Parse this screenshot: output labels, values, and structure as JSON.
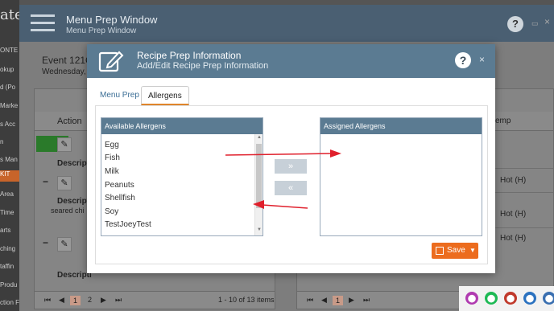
{
  "background_app": {
    "brand": "ate",
    "nav": [
      "ONTE",
      "okup",
      "d (Po",
      "Marke",
      "s Acc",
      "n",
      "s Man",
      "KIT",
      "Area",
      "Time",
      "arts",
      "ching",
      "taffin",
      "Produ",
      "ction F"
    ]
  },
  "menu_prep_window": {
    "title": "Menu Prep Window",
    "subtitle": "Menu Prep Window",
    "help": "?",
    "close": "×",
    "event": "Event 121C",
    "date": "Wednesday,",
    "left_grid": {
      "action_header": "Action",
      "description_label": "Descripti",
      "description_label2": "Descripti",
      "description_text": "seared chi",
      "description_label3": "Descripti",
      "pager_items": [
        "⏮",
        "◀",
        "1",
        "2",
        "▶",
        "⏭"
      ],
      "pager_summary": "1 - 10 of 13 items"
    },
    "right_grid": {
      "temp_header": "emp",
      "hot_values": [
        "Hot (H)",
        "Hot (H)",
        "Hot (H)"
      ],
      "pager_items": [
        "⏮",
        "◀",
        "1",
        "▶",
        "⏭"
      ]
    }
  },
  "modal": {
    "title": "Recipe Prep Information",
    "subtitle": "Add/Edit Recipe Prep Information",
    "help": "?",
    "close": "×",
    "tabs": [
      {
        "label": "Menu Prep",
        "active": false
      },
      {
        "label": "Allergens",
        "active": true
      }
    ],
    "available": {
      "header": "Available Allergens",
      "items": [
        "Egg",
        "Fish",
        "Milk",
        "Peanuts",
        "Shellfish",
        "Soy",
        "TestJoeyTest"
      ]
    },
    "assigned": {
      "header": "Assigned Allergens",
      "items": []
    },
    "move_right": "»",
    "move_left": "«",
    "save_label": "Save",
    "save_caret": "▼"
  },
  "colors": {
    "modal_header": "#5b7b92",
    "save": "#ec6c1e",
    "annotation_arrow": "#e0202c",
    "active_tab_underline": "#e0852b"
  },
  "tray": [
    "⬤",
    "⬤",
    "⬤",
    "⬤",
    "⬤"
  ]
}
